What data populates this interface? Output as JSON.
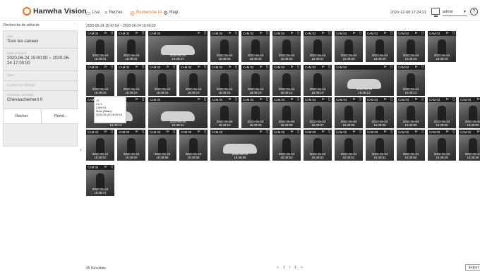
{
  "app": {
    "brand": "Hanwha Vision"
  },
  "nav": [
    {
      "label": "Live",
      "icon": "monitor-icon",
      "active": false
    },
    {
      "label": "Recher.",
      "icon": "search-icon",
      "active": false
    },
    {
      "label": "Recherche IA",
      "icon": "ai-search-icon",
      "active": true
    },
    {
      "label": "Régl.",
      "icon": "gear-icon",
      "active": false
    }
  ],
  "header": {
    "datetime": "2020-12-08 17:24:21",
    "user": "admin",
    "help": "?"
  },
  "sidebar": {
    "title": "Recherche de véhicule",
    "more": "···",
    "fields": [
      {
        "label": "Voie",
        "value": "Tous les canaux"
      },
      {
        "label": "Date et heure",
        "value": "2020-06-24 15:00:00 ~ 2020-06-24 17:00:00"
      },
      {
        "label": "Type",
        "value": ""
      },
      {
        "label": "Couleur du véhicule",
        "value": ""
      },
      {
        "label": "Cheveux, données",
        "value": "Chevauchement 0"
      }
    ],
    "search_button": "Recher.",
    "reset_button": "Réinit."
  },
  "results": {
    "range": "2020-06-24 15:47:54 ~ 2020-06-24 16:49:29",
    "count_label": "45 Résultats",
    "pager": {
      "prev": "<",
      "current": "1",
      "sep": "/",
      "total": "1",
      "next": ">"
    },
    "export_label": "Export",
    "thumbs": [
      {
        "cam": "CAM 03",
        "date": "2020-06-24",
        "time": "16:49:31"
      },
      {
        "cam": "CAM 03",
        "date": "2020-06-24",
        "time": "16:49:31"
      },
      {
        "cam": "CAM 03",
        "date": "2020-06-24",
        "time": "16:49:27"
      },
      {
        "cam": "CAM 03",
        "date": "2020-06-24",
        "time": "16:49:26"
      },
      {
        "cam": "CAM 03",
        "date": "2020-06-24",
        "time": "16:49:26"
      },
      {
        "cam": "CAM 03",
        "date": "2020-06-24",
        "time": "16:49:22"
      },
      {
        "cam": "CAM 03",
        "date": "2020-06-24",
        "time": "16:49:21"
      },
      {
        "cam": "CAM 03",
        "date": "2020-06-24",
        "time": "16:49:20"
      },
      {
        "cam": "CAM 03",
        "date": "2020-06-24",
        "time": "16:49:20"
      },
      {
        "cam": "CAM 03",
        "date": "2020-06-24",
        "time": "16:49:19"
      },
      {
        "cam": "CAM 03",
        "date": "2020-06-24",
        "time": "16:49:19"
      },
      {
        "cam": "CAM 03",
        "date": "2020-06-24",
        "time": "16:49:18"
      },
      {
        "cam": "CAM 03",
        "date": "2020-06-24",
        "time": "16:49:18"
      },
      {
        "cam": "CAM 03",
        "date": "2020-06-24",
        "time": "16:49:16"
      },
      {
        "cam": "CAM 03",
        "date": "2020-06-24",
        "time": "16:49:15"
      },
      {
        "cam": "CAM 03",
        "date": "2020-06-24",
        "time": "16:49:15"
      },
      {
        "cam": "CAM 03",
        "date": "2020-06-24",
        "time": "16:49:15"
      },
      {
        "cam": "CAM 03",
        "date": "2020-06-24",
        "time": "16:49:14"
      },
      {
        "cam": "CAM 03",
        "date": "2020-06-24",
        "time": "16:49:13"
      },
      {
        "cam": "CAM 03",
        "date": "2020-06-24",
        "time": "16:49:13"
      },
      {
        "cam": "CAM 03",
        "date": "2020-06-24",
        "time": "16:49:12"
      },
      {
        "cam": "CAM 03",
        "date": "2020-06-24",
        "time": "16:49:12"
      },
      {
        "cam": "CAM 03",
        "date": "2020-06-24",
        "time": "16:49:11"
      },
      {
        "cam": "CAM 03",
        "date": "2020-06-24",
        "time": "16:49:10"
      },
      {
        "cam": "CAM 03",
        "date": "2020-06-24",
        "time": "16:49:09"
      },
      {
        "cam": "CAM 03",
        "date": "2020-06-24",
        "time": "16:49:08"
      },
      {
        "cam": "CAM 03",
        "date": "2020-06-24",
        "time": "16:49:07"
      },
      {
        "cam": "CAM 03",
        "date": "2020-06-24",
        "time": "16:49:06"
      },
      {
        "cam": "CAM 03",
        "date": "2020-06-24",
        "time": "16:49:05"
      },
      {
        "cam": "CAM 03",
        "date": "2020-06-24",
        "time": "16:49:05"
      },
      {
        "cam": "CAM 03",
        "date": "2020-06-24",
        "time": "16:49:05"
      },
      {
        "cam": "CAM 03",
        "date": "2020-06-24",
        "time": "16:49:03"
      },
      {
        "cam": "CAM 03",
        "date": "2020-06-24",
        "time": "16:49:02"
      },
      {
        "cam": "CAM 03",
        "date": "2020-06-24",
        "time": "16:49:00"
      },
      {
        "cam": "CAM 03",
        "date": "2020-06-24",
        "time": "16:48:58"
      },
      {
        "cam": "CAM 03",
        "date": "2020-06-24",
        "time": "16:48:58"
      },
      {
        "cam": "CAM 03",
        "date": "2020-06-24",
        "time": "16:48:56"
      },
      {
        "cam": "CAM 03",
        "date": "2020-06-24",
        "time": "16:48:53"
      },
      {
        "cam": "CAM 03",
        "date": "2020-06-24",
        "time": "16:48:52"
      },
      {
        "cam": "CAM 03",
        "date": "2020-06-24",
        "time": "16:48:51"
      },
      {
        "cam": "CAM 03",
        "date": "2020-06-24",
        "time": "16:48:51"
      },
      {
        "cam": "CAM 03",
        "date": "2020-06-24",
        "time": "16:48:50"
      },
      {
        "cam": "CAM 03",
        "date": "2020-06-24",
        "time": "16:48:49"
      },
      {
        "cam": "CAM 03",
        "date": "2020-06-24",
        "time": "16:48:48"
      },
      {
        "cam": "CAM 03",
        "date": "2020-06-24",
        "time": "16:48:47"
      }
    ]
  },
  "tooltip": {
    "lines": [
      "15",
      "Ch.3",
      "CAM 03",
      "Moto (Blanc)",
      "2020-06-24 16:49:15"
    ]
  }
}
